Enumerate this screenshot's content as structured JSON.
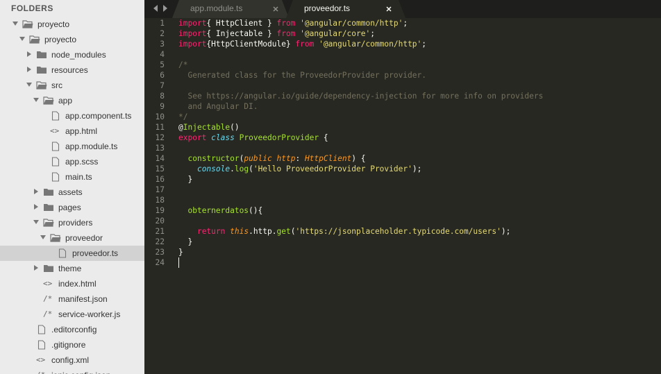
{
  "sidebar": {
    "header": "FOLDERS",
    "items": [
      {
        "label": "proyecto",
        "type": "folder",
        "open": true,
        "depth": 0
      },
      {
        "label": "proyecto",
        "type": "folder",
        "open": true,
        "depth": 1
      },
      {
        "label": "node_modules",
        "type": "folder",
        "open": false,
        "depth": 2
      },
      {
        "label": "resources",
        "type": "folder",
        "open": false,
        "depth": 2
      },
      {
        "label": "src",
        "type": "folder",
        "open": true,
        "depth": 2
      },
      {
        "label": "app",
        "type": "folder",
        "open": true,
        "depth": 3
      },
      {
        "label": "app.component.ts",
        "type": "file",
        "depth": 4
      },
      {
        "label": "app.html",
        "type": "code",
        "depth": 4
      },
      {
        "label": "app.module.ts",
        "type": "file",
        "depth": 4
      },
      {
        "label": "app.scss",
        "type": "file",
        "depth": 4
      },
      {
        "label": "main.ts",
        "type": "file",
        "depth": 4
      },
      {
        "label": "assets",
        "type": "folder",
        "open": false,
        "depth": 3
      },
      {
        "label": "pages",
        "type": "folder",
        "open": false,
        "depth": 3
      },
      {
        "label": "providers",
        "type": "folder",
        "open": true,
        "depth": 3
      },
      {
        "label": "proveedor",
        "type": "folder",
        "open": true,
        "depth": 4
      },
      {
        "label": "proveedor.ts",
        "type": "file",
        "depth": 5,
        "selected": true
      },
      {
        "label": "theme",
        "type": "folder",
        "open": false,
        "depth": 3
      },
      {
        "label": "index.html",
        "type": "code",
        "depth": 3
      },
      {
        "label": "manifest.json",
        "type": "comment",
        "depth": 3
      },
      {
        "label": "service-worker.js",
        "type": "comment",
        "depth": 3
      },
      {
        "label": ".editorconfig",
        "type": "file",
        "depth": 2
      },
      {
        "label": ".gitignore",
        "type": "file",
        "depth": 2
      },
      {
        "label": "config.xml",
        "type": "code",
        "depth": 2
      },
      {
        "label": "ionic.config.json",
        "type": "comment",
        "depth": 2
      }
    ]
  },
  "tabs": [
    {
      "label": "app.module.ts",
      "active": false
    },
    {
      "label": "proveedor.ts",
      "active": true
    }
  ],
  "editor": {
    "lines": [
      [
        [
          "kw",
          "import"
        ],
        [
          "",
          "{ HttpClient } "
        ],
        [
          "kw",
          "from"
        ],
        [
          "str",
          " '@angular/common/http'"
        ],
        [
          "",
          ";"
        ]
      ],
      [
        [
          "kw",
          "import"
        ],
        [
          "",
          "{ Injectable } "
        ],
        [
          "kw",
          "from"
        ],
        [
          "str",
          " '@angular/core'"
        ],
        [
          "",
          ";"
        ]
      ],
      [
        [
          "kw",
          "import"
        ],
        [
          "",
          "{HttpClientModule} "
        ],
        [
          "kw",
          "from"
        ],
        [
          "str",
          " '@angular/common/http'"
        ],
        [
          "",
          ";"
        ]
      ],
      [],
      [
        [
          "cmt",
          "/*"
        ]
      ],
      [
        [
          "cmt",
          "  Generated class for the ProveedorProvider provider."
        ]
      ],
      [],
      [
        [
          "cmt",
          "  See https://angular.io/guide/dependency-injection for more info on providers"
        ]
      ],
      [
        [
          "cmt",
          "  and Angular DI."
        ]
      ],
      [
        [
          "cmt",
          "*/"
        ]
      ],
      [
        [
          "",
          "@"
        ],
        [
          "fn",
          "Injectable"
        ],
        [
          "",
          "()"
        ]
      ],
      [
        [
          "kw",
          "export"
        ],
        [
          "",
          " "
        ],
        [
          "ital",
          "class"
        ],
        [
          "",
          " "
        ],
        [
          "fn",
          "ProveedorProvider"
        ],
        [
          "",
          " {"
        ]
      ],
      [],
      [
        [
          "",
          "  "
        ],
        [
          "fn",
          "constructor"
        ],
        [
          "",
          "("
        ],
        [
          "param",
          "public"
        ],
        [
          "",
          " "
        ],
        [
          "param",
          "http"
        ],
        [
          "",
          ": "
        ],
        [
          "param",
          "HttpClient"
        ],
        [
          "",
          ") {"
        ]
      ],
      [
        [
          "",
          "    "
        ],
        [
          "ital",
          "console"
        ],
        [
          "",
          "."
        ],
        [
          "fn",
          "log"
        ],
        [
          "",
          "("
        ],
        [
          "str",
          "'Hello ProveedorProvider Provider'"
        ],
        [
          "",
          ");"
        ]
      ],
      [
        [
          "",
          "  }"
        ]
      ],
      [],
      [],
      [
        [
          "",
          "  "
        ],
        [
          "fn",
          "obternerdatos"
        ],
        [
          "",
          "(){"
        ]
      ],
      [],
      [
        [
          "",
          "    "
        ],
        [
          "kw",
          "return"
        ],
        [
          "",
          " "
        ],
        [
          "param",
          "this"
        ],
        [
          "",
          ".http."
        ],
        [
          "fn",
          "get"
        ],
        [
          "",
          "("
        ],
        [
          "str",
          "'https://jsonplaceholder.typicode.com/users'"
        ],
        [
          "",
          ");"
        ]
      ],
      [
        [
          "",
          "  }"
        ]
      ],
      [
        [
          "",
          "}"
        ]
      ],
      []
    ]
  }
}
